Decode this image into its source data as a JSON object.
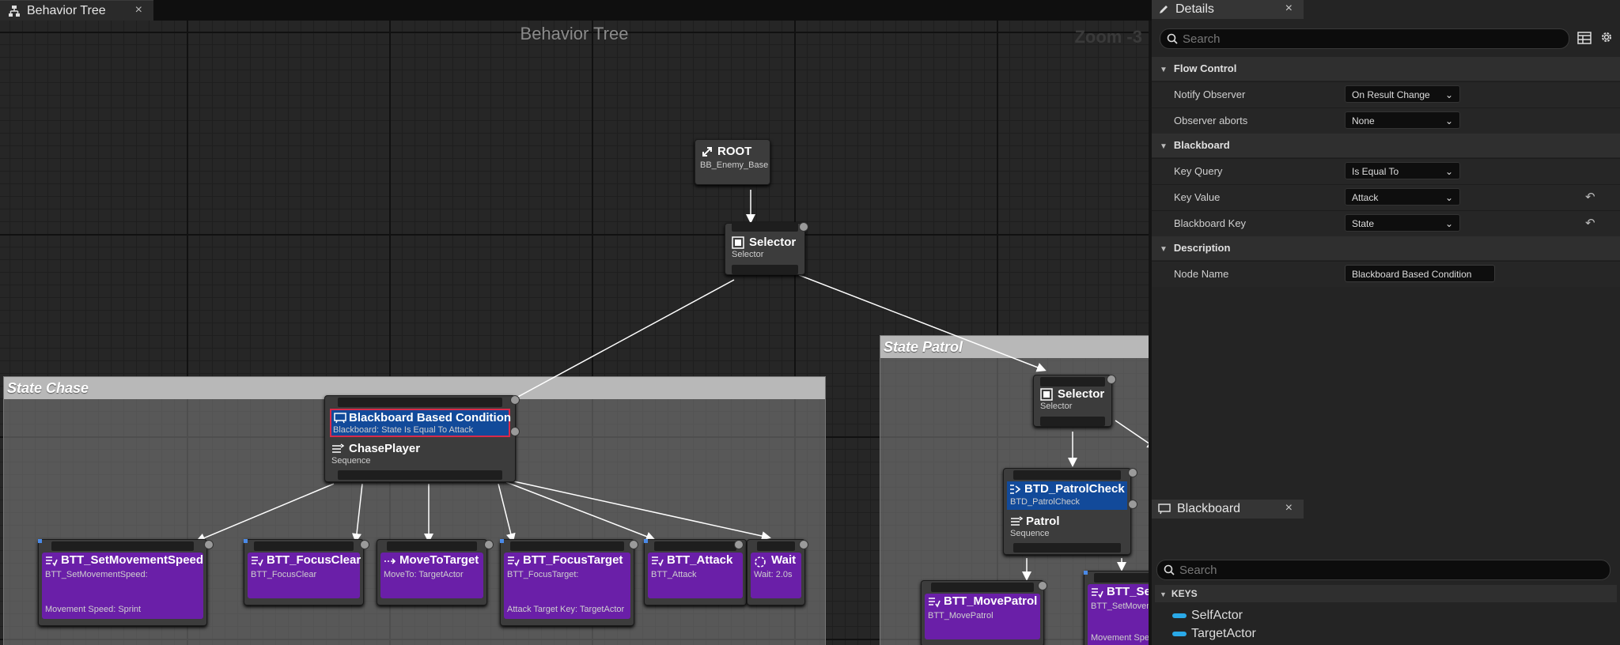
{
  "tab": {
    "label": "Behavior Tree",
    "close": "×"
  },
  "graph": {
    "title": "Behavior Tree",
    "zoom": "Zoom -3"
  },
  "comments": {
    "chase": "State Chase",
    "patrol": "State Patrol"
  },
  "nodes": {
    "root": {
      "title": "ROOT",
      "sub": "BB_Enemy_Base"
    },
    "selector1": {
      "title": "Selector",
      "sub": "Selector"
    },
    "bb_condition": {
      "title": "Blackboard Based Condition",
      "sub": "Blackboard: State Is Equal To Attack"
    },
    "chase_player": {
      "title": "ChasePlayer",
      "sub": "Sequence"
    },
    "set_speed": {
      "title": "BTT_SetMovementSpeed",
      "sub": "BTT_SetMovementSpeed:",
      "detail": "Movement Speed: Sprint"
    },
    "focus_clear": {
      "title": "BTT_FocusClear",
      "sub": "BTT_FocusClear"
    },
    "move_to": {
      "title": "MoveToTarget",
      "sub": "MoveTo: TargetActor"
    },
    "focus_target": {
      "title": "BTT_FocusTarget",
      "sub": "BTT_FocusTarget:",
      "detail": "Attack Target Key: TargetActor"
    },
    "attack": {
      "title": "BTT_Attack",
      "sub": "BTT_Attack"
    },
    "wait": {
      "title": "Wait",
      "sub": "Wait: 2.0s"
    },
    "selector2": {
      "title": "Selector",
      "sub": "Selector"
    },
    "patrol_check": {
      "title": "BTD_PatrolCheck",
      "sub": "BTD_PatrolCheck"
    },
    "patrol": {
      "title": "Patrol",
      "sub": "Sequence"
    },
    "move_patrol": {
      "title": "BTT_MovePatrol",
      "sub": "BTT_MovePatrol"
    },
    "btt_se": {
      "title": "BTT_Se",
      "sub": "BTT_SetMoven",
      "detail": "Movement Spe"
    }
  },
  "details": {
    "tab_label": "Details",
    "close": "×",
    "search_placeholder": "Search",
    "sections": {
      "flow_control": "Flow Control",
      "blackboard": "Blackboard",
      "description": "Description"
    },
    "rows": {
      "notify_observer": {
        "label": "Notify Observer",
        "value": "On Result Change"
      },
      "observer_aborts": {
        "label": "Observer aborts",
        "value": "None"
      },
      "key_query": {
        "label": "Key Query",
        "value": "Is Equal To"
      },
      "key_value": {
        "label": "Key Value",
        "value": "Attack"
      },
      "blackboard_key": {
        "label": "Blackboard Key",
        "value": "State"
      },
      "node_name": {
        "label": "Node Name",
        "value": "Blackboard Based Condition"
      }
    }
  },
  "blackboard_panel": {
    "tab_label": "Blackboard",
    "close": "×",
    "search_placeholder": "Search",
    "keys_header": "KEYS",
    "keys": [
      "SelfActor",
      "TargetActor"
    ]
  },
  "colors": {
    "task": "#6a1fa8",
    "decorator": "#124a9a",
    "key": "#2aa9e8"
  }
}
